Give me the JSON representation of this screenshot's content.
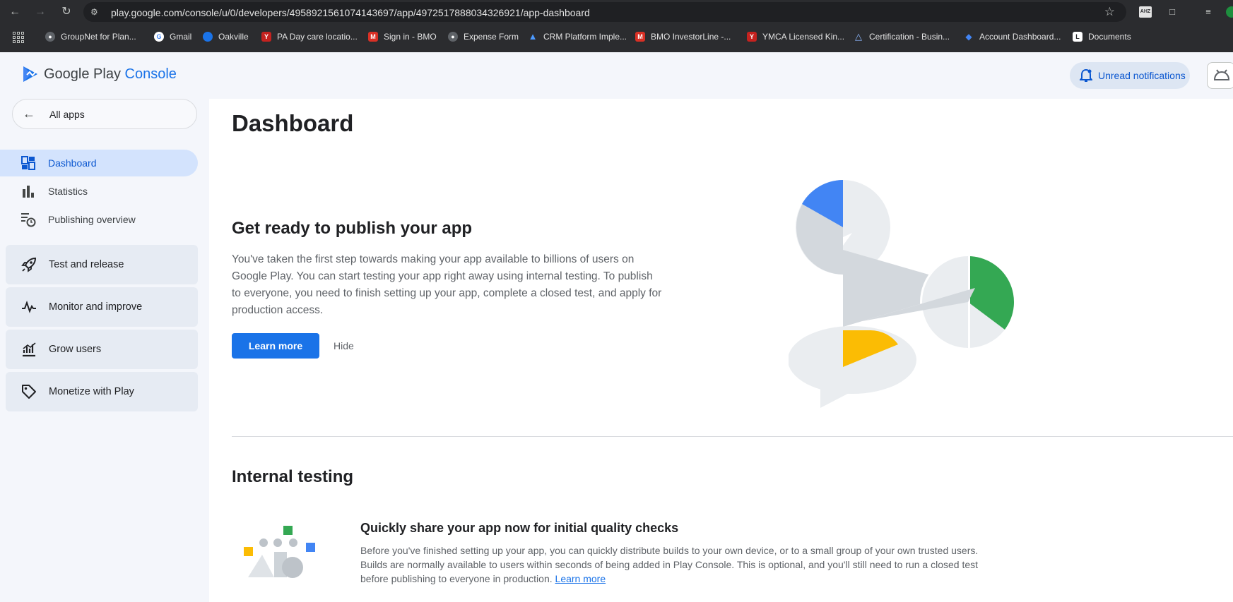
{
  "browser": {
    "url": "play.google.com/console/u/0/developers/4958921561074143697/app/4972517888034326921/app-dashboard",
    "bookmarks": [
      {
        "label": "GroupNet for Plan...",
        "icon": "globe-icon"
      },
      {
        "label": "Gmail",
        "icon": "google-icon"
      },
      {
        "label": "Oakville",
        "icon": "cloud-icon"
      },
      {
        "label": "PA Day care locatio...",
        "icon": "ymca-icon"
      },
      {
        "label": "Sign in - BMO",
        "icon": "bmo-icon"
      },
      {
        "label": "Expense Form",
        "icon": "globe-icon"
      },
      {
        "label": "CRM Platform Imple...",
        "icon": "atlassian-icon"
      },
      {
        "label": "BMO InvestorLine -...",
        "icon": "bmo-icon"
      },
      {
        "label": "YMCA Licensed Kin...",
        "icon": "ymca-icon"
      },
      {
        "label": "Certification - Busin...",
        "icon": "cert-icon"
      },
      {
        "label": "Account Dashboard...",
        "icon": "dashboard-icon"
      },
      {
        "label": "Documents",
        "icon": "docs-icon"
      }
    ]
  },
  "header": {
    "logo_text_main": "Google Play",
    "logo_text_accent": "Console",
    "notifications_label": "Unread notifications"
  },
  "sidebar": {
    "all_apps_label": "All apps",
    "items": [
      {
        "label": "Dashboard",
        "active": true,
        "icon": "dashboard-icon"
      },
      {
        "label": "Statistics",
        "active": false,
        "icon": "bar-chart-icon"
      },
      {
        "label": "Publishing overview",
        "active": false,
        "icon": "publishing-clock-icon"
      }
    ],
    "groups": [
      {
        "label": "Test and release",
        "icon": "rocket-icon"
      },
      {
        "label": "Monitor and improve",
        "icon": "vitals-icon"
      },
      {
        "label": "Grow users",
        "icon": "growth-icon"
      },
      {
        "label": "Monetize with Play",
        "icon": "tag-icon"
      }
    ]
  },
  "main": {
    "page_title": "Dashboard",
    "hero": {
      "title": "Get ready to publish your app",
      "body": "You've taken the first step towards making your app available to billions of users on Google Play. You can start testing your app right away using internal testing. To publish to everyone, you need to finish setting up your app, complete a closed test, and apply for production access.",
      "primary_button": "Learn more",
      "secondary_button": "Hide"
    },
    "internal_testing": {
      "section_title": "Internal testing",
      "card_title": "Quickly share your app now for initial quality checks",
      "card_body": "Before you've finished setting up your app, you can quickly distribute builds to your own device, or to a small group of your own trusted users. Builds are normally available to users within seconds of being added in Play Console. This is optional, and you'll still need to run a closed test before publishing to everyone in production.",
      "card_link": "Learn more"
    }
  },
  "colors": {
    "accent": "#1a73e8",
    "active_nav_bg": "#d3e3fd",
    "green": "#34a853",
    "yellow": "#fbbc04",
    "blue": "#4285f4"
  }
}
